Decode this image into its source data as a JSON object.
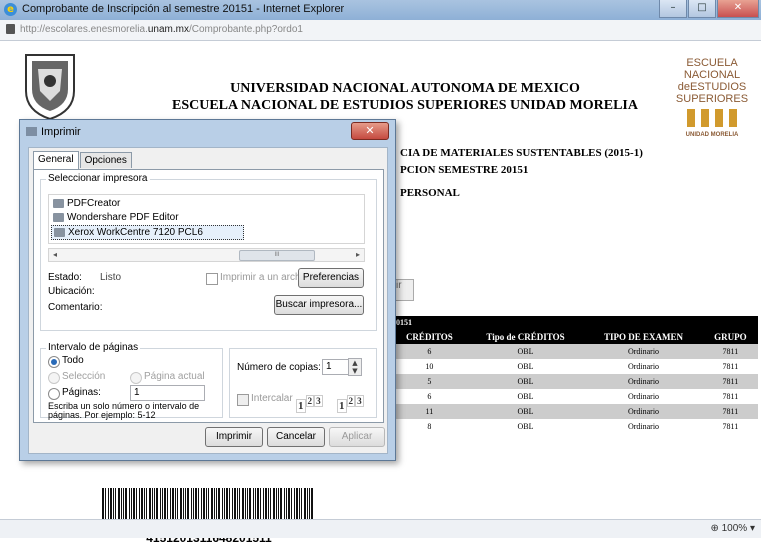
{
  "browser": {
    "window_title": "Comprobante de Inscripción al semestre 20151 - Internet Explorer",
    "url_prefix": "http://escolares.enesmorelia.",
    "url_domain": "unam.mx",
    "url_suffix": "/Comprobante.php?ordo1",
    "zoom": "100%",
    "controls": {
      "minimize": "–",
      "maximize": "□",
      "close": "✕"
    }
  },
  "page": {
    "heading_line1": "UNIVERSIDAD NACIONAL AUTONOMA DE MEXICO",
    "heading_line2": "ESCUELA NACIONAL DE ESTUDIOS SUPERIORES UNIDAD MORELIA",
    "career_partial": "CIA DE MATERIALES SUSTENTABLES (2015-1)",
    "inscription_partial": "PCION SEMESTRE 20151",
    "personal_partial": "PERSONAL",
    "button_partial": "ir",
    "logo": {
      "lines": [
        "ESCUELA",
        "NACIONAL",
        "deESTUDIOS",
        "SUPERIORES"
      ],
      "subtitle": "UNIDAD MORELIA",
      "color": "#8a5a34",
      "columns_color": "#d19a2d"
    },
    "barcode_number": "4151201311648201511"
  },
  "grades_table": {
    "year_row": "0151",
    "headers": [
      "CRÉDITOS",
      "Tipo de CRÉDITOS",
      "TIPO DE EXAMEN",
      "GRUPO"
    ],
    "rows": [
      [
        "6",
        "OBL",
        "Ordinario",
        "7811"
      ],
      [
        "10",
        "OBL",
        "Ordinario",
        "7811"
      ],
      [
        "5",
        "OBL",
        "Ordinario",
        "7811"
      ],
      [
        "6",
        "OBL",
        "Ordinario",
        "7811"
      ],
      [
        "11",
        "OBL",
        "Ordinario",
        "7811"
      ],
      [
        "8",
        "OBL",
        "Ordinario",
        "7811"
      ]
    ]
  },
  "print_dialog": {
    "title": "Imprimir",
    "close": "✕",
    "tabs": [
      "General",
      "Opciones"
    ],
    "select_printer_label": "Seleccionar impresora",
    "printers": [
      "PDFCreator",
      "Wondershare PDF Editor",
      "Xerox WorkCentre 7120 PCL6"
    ],
    "selected_printer_index": 2,
    "scroll_left": "◂",
    "scroll_right": "▸",
    "scroll_grip": "III",
    "estado_label": "Estado:",
    "estado_value": "Listo",
    "ubicacion_label": "Ubicación:",
    "comentario_label": "Comentario:",
    "print_to_file_label": "Imprimir a un archivo",
    "preferences_button": "Preferencias",
    "find_printer_button": "Buscar impresora...",
    "page_range_label": "Intervalo de páginas",
    "option_all": "Todo",
    "option_selection": "Selección",
    "option_current_page": "Página actual",
    "option_pages": "Páginas:",
    "pages_value": "1",
    "page_range_hint": "Escriba un solo número o intervalo de páginas. Por ejemplo: 5-12",
    "copies_label": "Número de copias:",
    "copies_value": "1",
    "collate_label": "Intercalar",
    "collate_digits": [
      "1",
      "2",
      "3"
    ],
    "print_button": "Imprimir",
    "cancel_button": "Cancelar",
    "apply_button": "Aplicar"
  }
}
